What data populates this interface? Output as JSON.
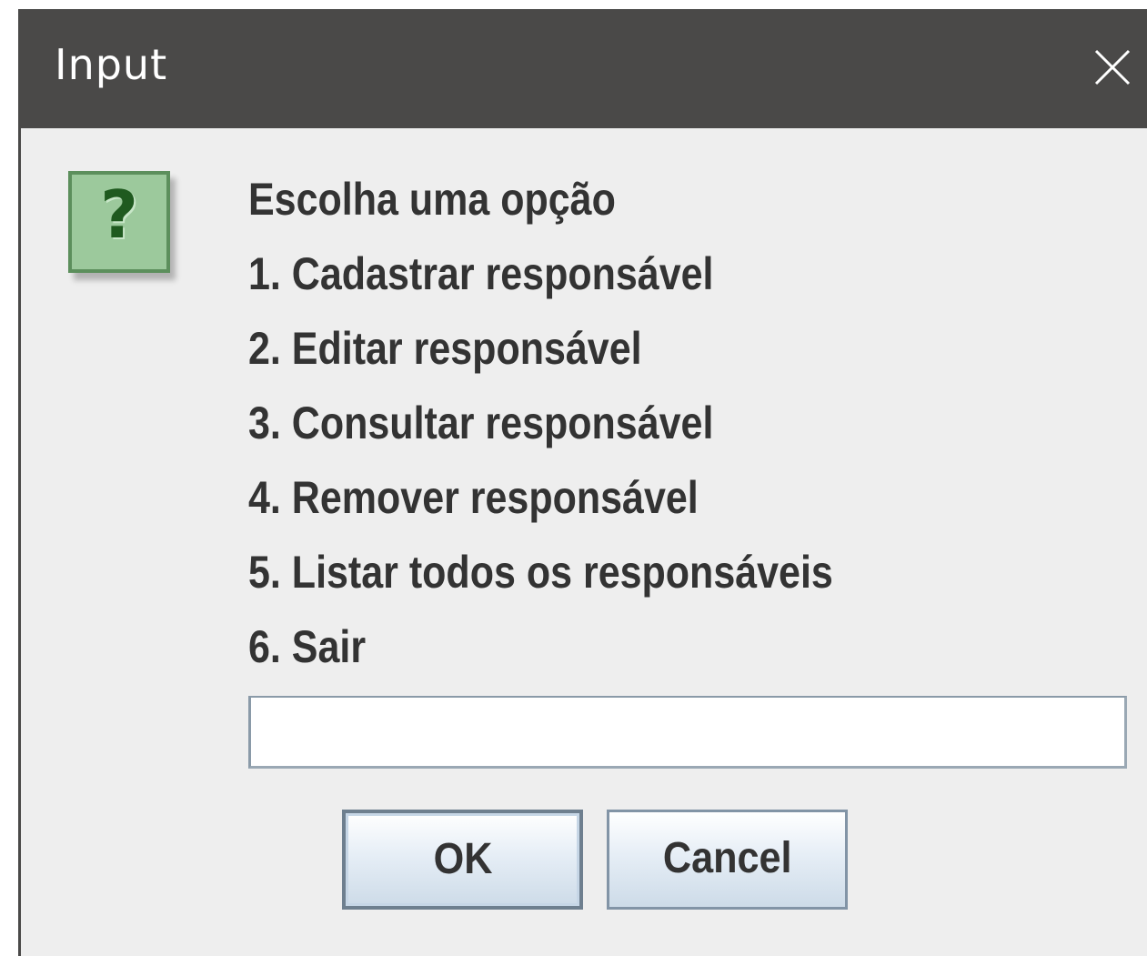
{
  "window": {
    "title": "Input",
    "close_icon": "close-icon"
  },
  "dialog": {
    "icon": "question-icon",
    "icon_glyph": "?",
    "message_lines": [
      "Escolha uma opção",
      "1. Cadastrar responsável",
      "2. Editar responsável",
      "3. Consultar responsável",
      "4. Remover responsável",
      "5. Listar todos os responsáveis",
      "6. Sair"
    ],
    "input": {
      "value": "",
      "placeholder": ""
    },
    "buttons": {
      "ok_label": "OK",
      "cancel_label": "Cancel"
    }
  },
  "colors": {
    "titlebar": "#4a4948",
    "background": "#eeeeee",
    "icon_fill": "#9cc99c",
    "icon_border": "#5c8f5c",
    "text": "#333333"
  }
}
